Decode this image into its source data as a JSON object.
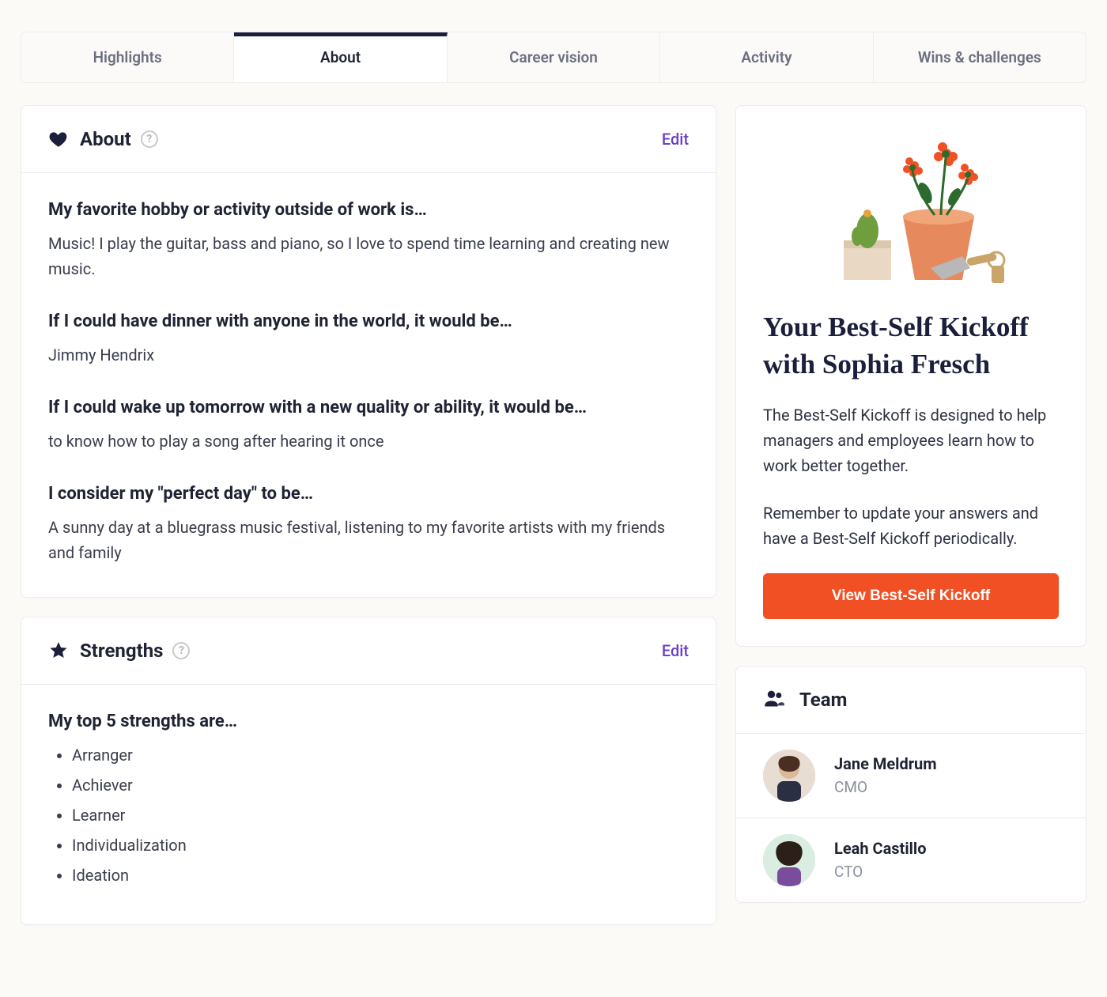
{
  "tabs": {
    "highlights": "Highlights",
    "about": "About",
    "career_vision": "Career vision",
    "activity": "Activity",
    "wins_challenges": "Wins & challenges"
  },
  "about_card": {
    "title": "About",
    "edit": "Edit",
    "q1": "My favorite hobby or activity outside of work is…",
    "a1": "Music! I play the guitar, bass and piano, so I love to spend time learning and creating new music.",
    "q2": "If I could have dinner with anyone in the world, it would be…",
    "a2": "Jimmy Hendrix",
    "q3": "If I could wake up tomorrow with a new quality or ability, it would be…",
    "a3": "to know how to play a song after hearing it once",
    "q4": "I consider my \"perfect day\" to be…",
    "a4": "A sunny day at a bluegrass music festival, listening to my favorite artists with my friends and family"
  },
  "strengths_card": {
    "title": "Strengths",
    "edit": "Edit",
    "q1": "My top 5 strengths are…",
    "items": [
      "Arranger",
      "Achiever",
      "Learner",
      "Individualization",
      "Ideation"
    ]
  },
  "kickoff": {
    "title": "Your Best-Self Kickoff with Sophia Fresch",
    "p1": "The Best-Self Kickoff is designed to help managers and employees learn how to work better together.",
    "p2": "Remember to update your answers and have a Best-Self Kickoff periodically.",
    "cta": "View Best-Self Kickoff"
  },
  "team": {
    "title": "Team",
    "members": [
      {
        "name": "Jane Meldrum",
        "title": "CMO"
      },
      {
        "name": "Leah Castillo",
        "title": "CTO"
      }
    ]
  }
}
